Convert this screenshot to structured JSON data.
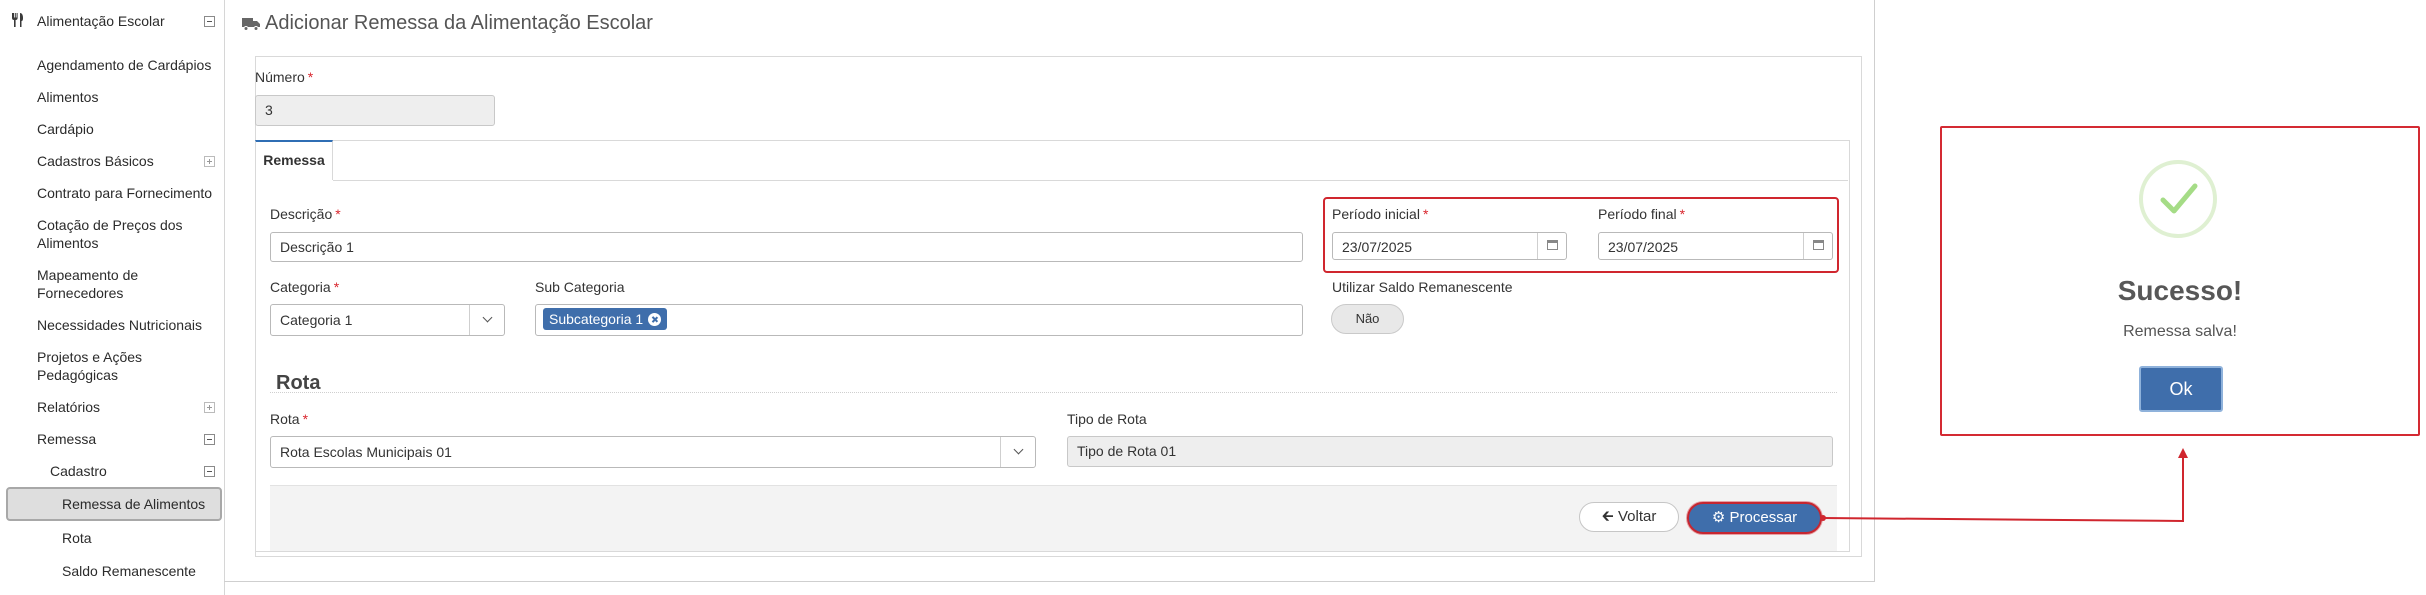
{
  "sidebar": {
    "section_title": "Alimentação Escolar",
    "items": [
      {
        "label": "Agendamento de Cardápios"
      },
      {
        "label": "Alimentos"
      },
      {
        "label": "Cardápio"
      },
      {
        "label": "Cadastros Básicos"
      },
      {
        "label": "Contrato para Fornecimento"
      },
      {
        "label": "Cotação de Preços dos"
      },
      {
        "label": "Alimentos"
      },
      {
        "label": "Mapeamento de"
      },
      {
        "label": "Fornecedores"
      },
      {
        "label": "Necessidades Nutricionais"
      },
      {
        "label": "Projetos e Ações"
      },
      {
        "label": "Pedagógicas"
      },
      {
        "label": "Relatórios"
      },
      {
        "label": "Remessa"
      },
      {
        "label": "Cadastro"
      },
      {
        "label": "Remessa de Alimentos"
      },
      {
        "label": "Rota"
      },
      {
        "label": "Saldo Remanescente"
      }
    ]
  },
  "page": {
    "title": "Adicionar Remessa da Alimentação Escolar"
  },
  "form": {
    "numero": {
      "label": "Número",
      "required": "*",
      "value": "3"
    },
    "tab": "Remessa",
    "descricao": {
      "label": "Descrição",
      "required": "*",
      "value": "Descrição 1"
    },
    "periodo_inicial": {
      "label": "Período inicial",
      "required": "*",
      "value": "23/07/2025"
    },
    "periodo_final": {
      "label": "Período final",
      "required": "*",
      "value": "23/07/2025"
    },
    "categoria": {
      "label": "Categoria",
      "required": "*",
      "value": "Categoria 1"
    },
    "sub_categoria": {
      "label": "Sub Categoria",
      "tag": "Subcategoria 1"
    },
    "saldo": {
      "label": "Utilizar Saldo Remanescente",
      "value": "Não"
    },
    "rota_section": "Rota",
    "rota": {
      "label": "Rota",
      "required": "*",
      "value": "Rota Escolas Municipais 01"
    },
    "tipo_rota": {
      "label": "Tipo de Rota",
      "value": "Tipo de Rota 01"
    }
  },
  "buttons": {
    "voltar": "Voltar",
    "processar": "Processar"
  },
  "dialog": {
    "title": "Sucesso!",
    "message": "Remessa salva!",
    "ok": "Ok"
  },
  "colors": {
    "primary": "#3f6eab",
    "highlight": "#d0262e",
    "success": "#a5dc86"
  }
}
